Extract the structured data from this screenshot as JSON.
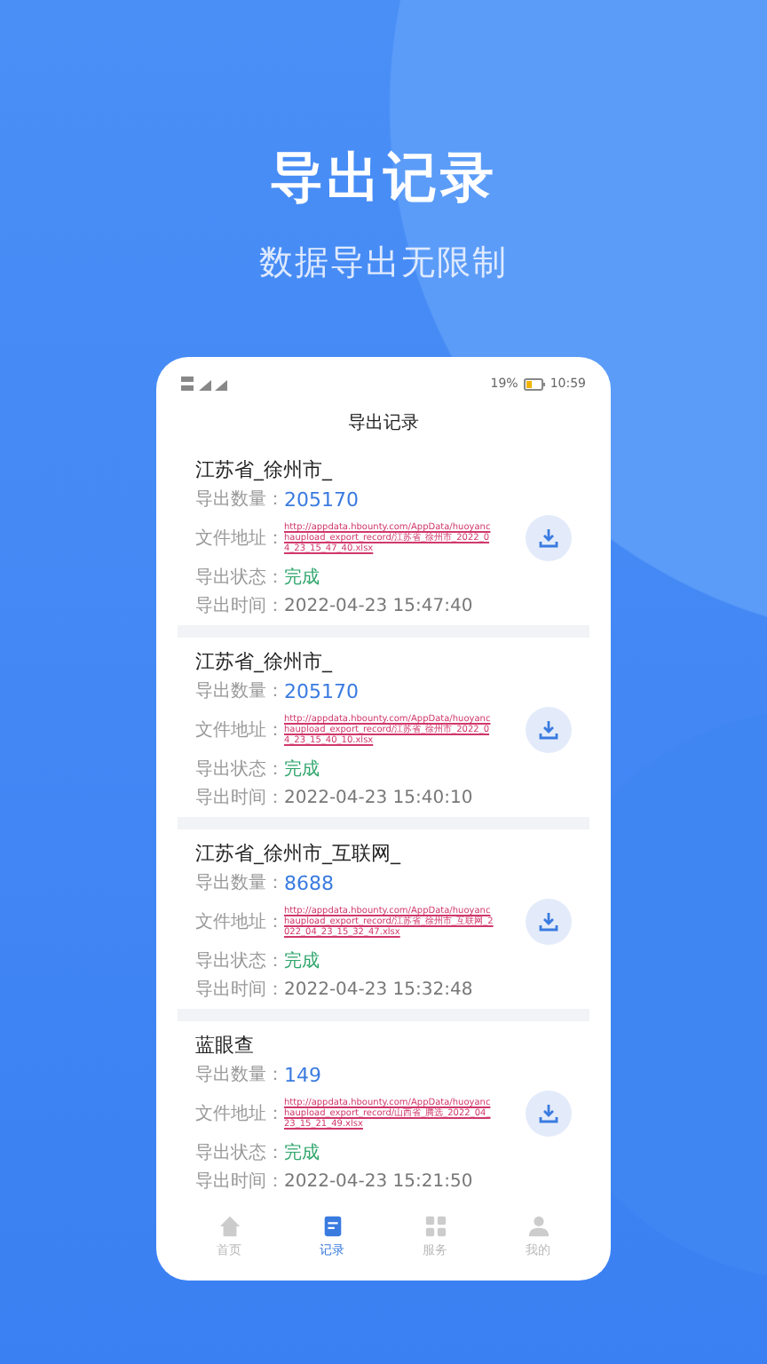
{
  "headline": "导出记录",
  "subheadline": "数据导出无限制",
  "phone": {
    "status_bar": {
      "battery": "19%",
      "time": "10:59"
    },
    "title": "导出记录",
    "records": [
      {
        "name": "江苏省_徐州市_",
        "count_label": "导出数量：",
        "count": "205170",
        "file_label": "文件地址：",
        "file_url": "http://appdata.hbounty.com/AppData/huoyanchaupload_export_record/江苏省_徐州市_2022_04_23_15_47_40.xlsx",
        "status_label": "导出状态：",
        "status": "完成",
        "time_label": "导出时间：",
        "time": "2022-04-23 15:47:40"
      },
      {
        "name": "江苏省_徐州市_",
        "count_label": "导出数量：",
        "count": "205170",
        "file_label": "文件地址：",
        "file_url": "http://appdata.hbounty.com/AppData/huoyanchaupload_export_record/江苏省_徐州市_2022_04_23_15_40_10.xlsx",
        "status_label": "导出状态：",
        "status": "完成",
        "time_label": "导出时间：",
        "time": "2022-04-23 15:40:10"
      },
      {
        "name": "江苏省_徐州市_互联网_",
        "count_label": "导出数量：",
        "count": "8688",
        "file_label": "文件地址：",
        "file_url": "http://appdata.hbounty.com/AppData/huoyanchaupload_export_record/江苏省_徐州市_互联网_2022_04_23_15_32_47.xlsx",
        "status_label": "导出状态：",
        "status": "完成",
        "time_label": "导出时间：",
        "time": "2022-04-23 15:32:48"
      },
      {
        "name": "蓝眼查",
        "count_label": "导出数量：",
        "count": "149",
        "file_label": "文件地址：",
        "file_url": "http://appdata.hbounty.com/AppData/huoyanchaupload_export_record/山西省_腾选_2022_04_23_15_21_49.xlsx",
        "status_label": "导出状态：",
        "status": "完成",
        "time_label": "导出时间：",
        "time": "2022-04-23 15:21:50"
      }
    ],
    "nav": [
      {
        "kind": "home",
        "label": "首页",
        "selected": false
      },
      {
        "kind": "record",
        "label": "记录",
        "selected": true
      },
      {
        "kind": "grid",
        "label": "服务",
        "selected": false
      },
      {
        "kind": "person",
        "label": "我的",
        "selected": false
      }
    ]
  }
}
